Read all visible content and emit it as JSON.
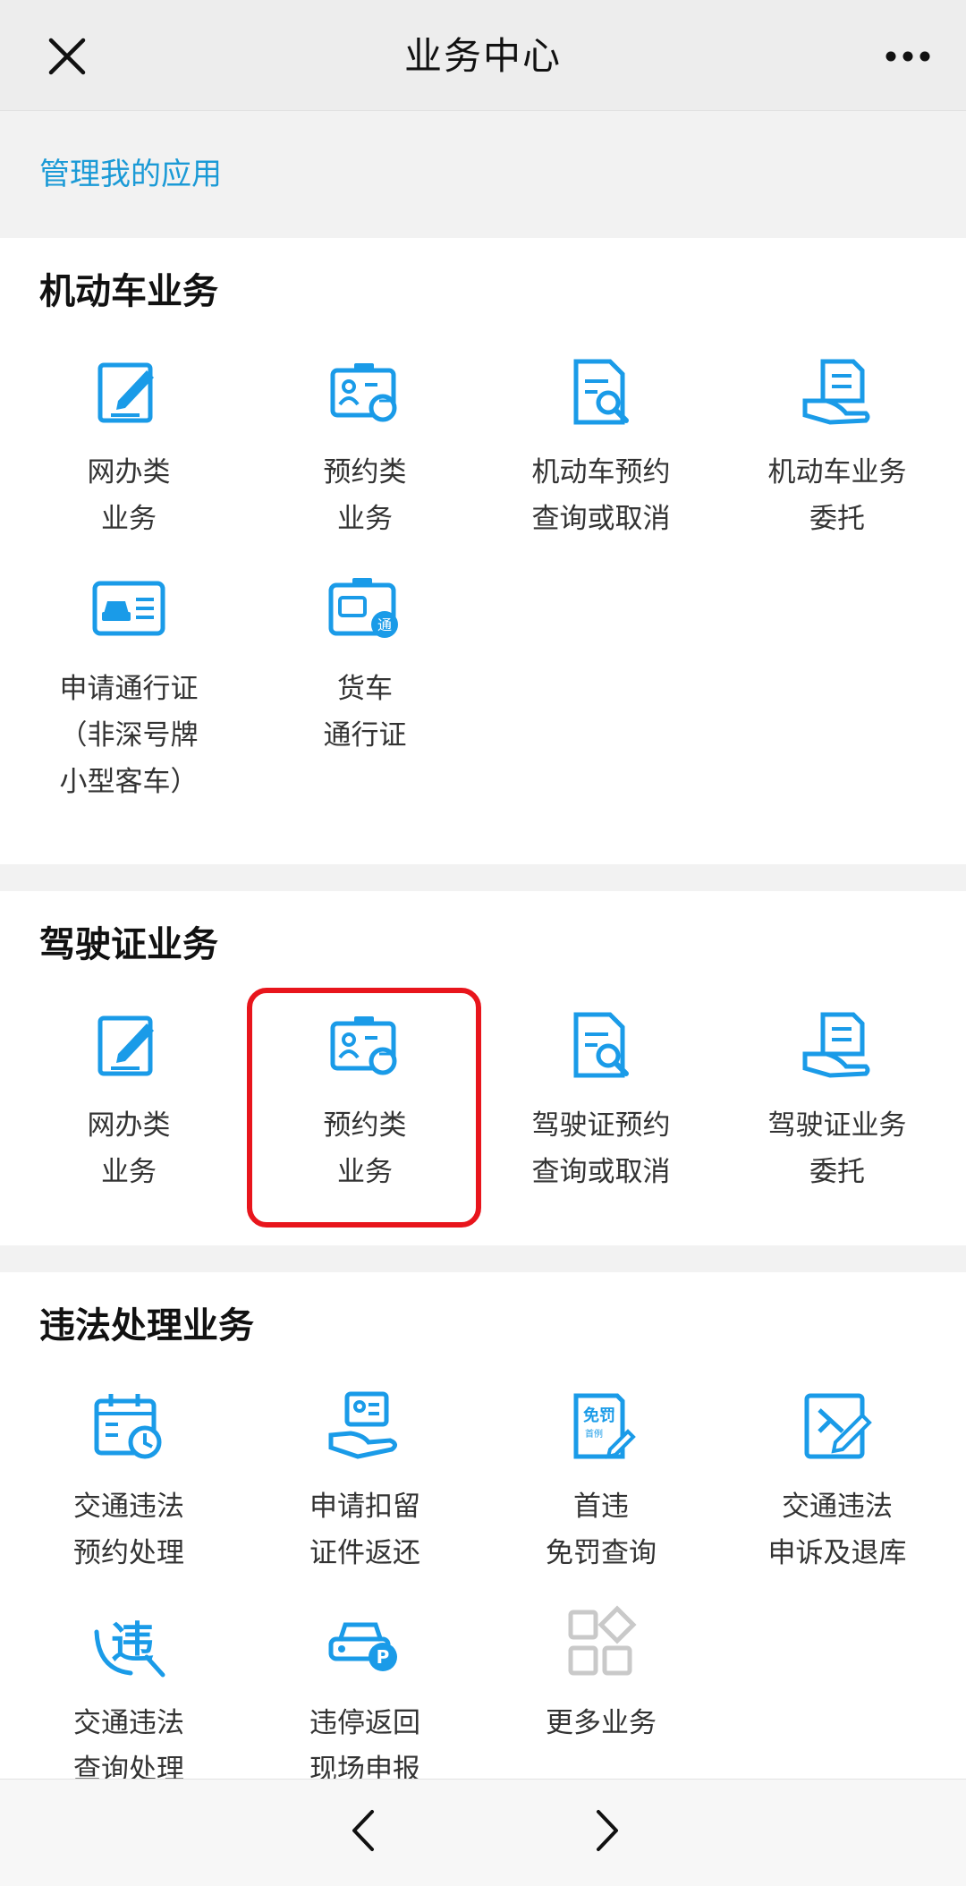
{
  "header": {
    "title": "业务中心",
    "close_icon": "close-icon",
    "more_icon": "more-icon"
  },
  "manage_link": "管理我的应用",
  "colors": {
    "accent": "#1b9ad6",
    "icon_blue": "#1a9be8",
    "highlight": "#e8151c",
    "disabled_icon": "#c9c9c9"
  },
  "sections": [
    {
      "title": "机动车业务",
      "items": [
        {
          "label": "网办类\n业务",
          "icon": "edit-document-icon"
        },
        {
          "label": "预约类\n业务",
          "icon": "id-card-refresh-icon"
        },
        {
          "label": "机动车预约\n查询或取消",
          "icon": "document-search-icon"
        },
        {
          "label": "机动车业务\n委托",
          "icon": "hand-document-icon"
        },
        {
          "label": "申请通行证\n（非深号牌\n小型客车）",
          "icon": "car-card-icon"
        },
        {
          "label": "货车\n通行证",
          "icon": "truck-pass-icon"
        }
      ]
    },
    {
      "title": "驾驶证业务",
      "items": [
        {
          "label": "网办类\n业务",
          "icon": "edit-document-icon"
        },
        {
          "label": "预约类\n业务",
          "icon": "id-card-refresh-icon"
        },
        {
          "label": "驾驶证预约\n查询或取消",
          "icon": "document-search-icon"
        },
        {
          "label": "驾驶证业务\n委托",
          "icon": "hand-document-icon"
        }
      ]
    },
    {
      "title": "违法处理业务",
      "items": [
        {
          "label": "交通违法\n预约处理",
          "icon": "calendar-clock-icon"
        },
        {
          "label": "申请扣留\n证件返还",
          "icon": "hand-id-icon"
        },
        {
          "label": "首违\n免罚查询",
          "icon": "fine-exempt-icon",
          "icon_text_top": "免罚",
          "icon_text_bottom": "首例"
        },
        {
          "label": "交通违法\n申诉及退库",
          "icon": "appeal-edit-icon"
        },
        {
          "label": "交通违法\n查询处理",
          "icon": "violation-icon",
          "icon_text_top": "违"
        },
        {
          "label": "违停返回\n现场申报",
          "icon": "car-parking-icon",
          "icon_text_top": "P"
        },
        {
          "label": "更多业务",
          "icon": "more-apps-icon"
        }
      ]
    }
  ],
  "footer": {
    "back_icon": "chevron-left-icon",
    "forward_icon": "chevron-right-icon"
  }
}
